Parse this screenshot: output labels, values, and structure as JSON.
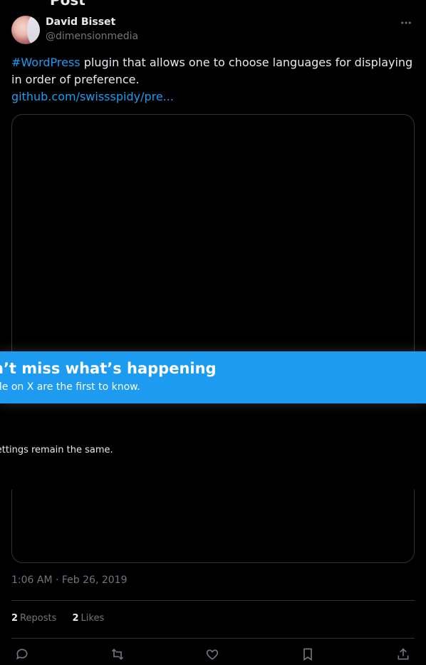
{
  "header": {
    "title": "Post"
  },
  "author": {
    "name": "David Bisset",
    "handle": "@dimensionmedia"
  },
  "tweet": {
    "hashtag": "#WordPress",
    "text": " plugin that allows one to choose languages for displaying in order of preference.",
    "link": "github.com/swissspidy/pre..."
  },
  "banner": {
    "title": "n’t miss what’s happening",
    "subtitle": "ple on X are the first to know."
  },
  "overlay": {
    "text": "settings remain the same."
  },
  "meta": {
    "timestamp": "1:06 AM · Feb 26, 2019"
  },
  "stats": {
    "reposts_count": "2",
    "reposts_label": "Reposts",
    "likes_count": "2",
    "likes_label": "Likes"
  },
  "icons": [
    "more-icon",
    "reply-icon",
    "repost-icon",
    "like-icon",
    "bookmark-icon",
    "share-icon"
  ],
  "colors": {
    "accent": "#1d9bf0",
    "background": "#000000",
    "muted": "#71767b",
    "divider": "#2f3336"
  }
}
